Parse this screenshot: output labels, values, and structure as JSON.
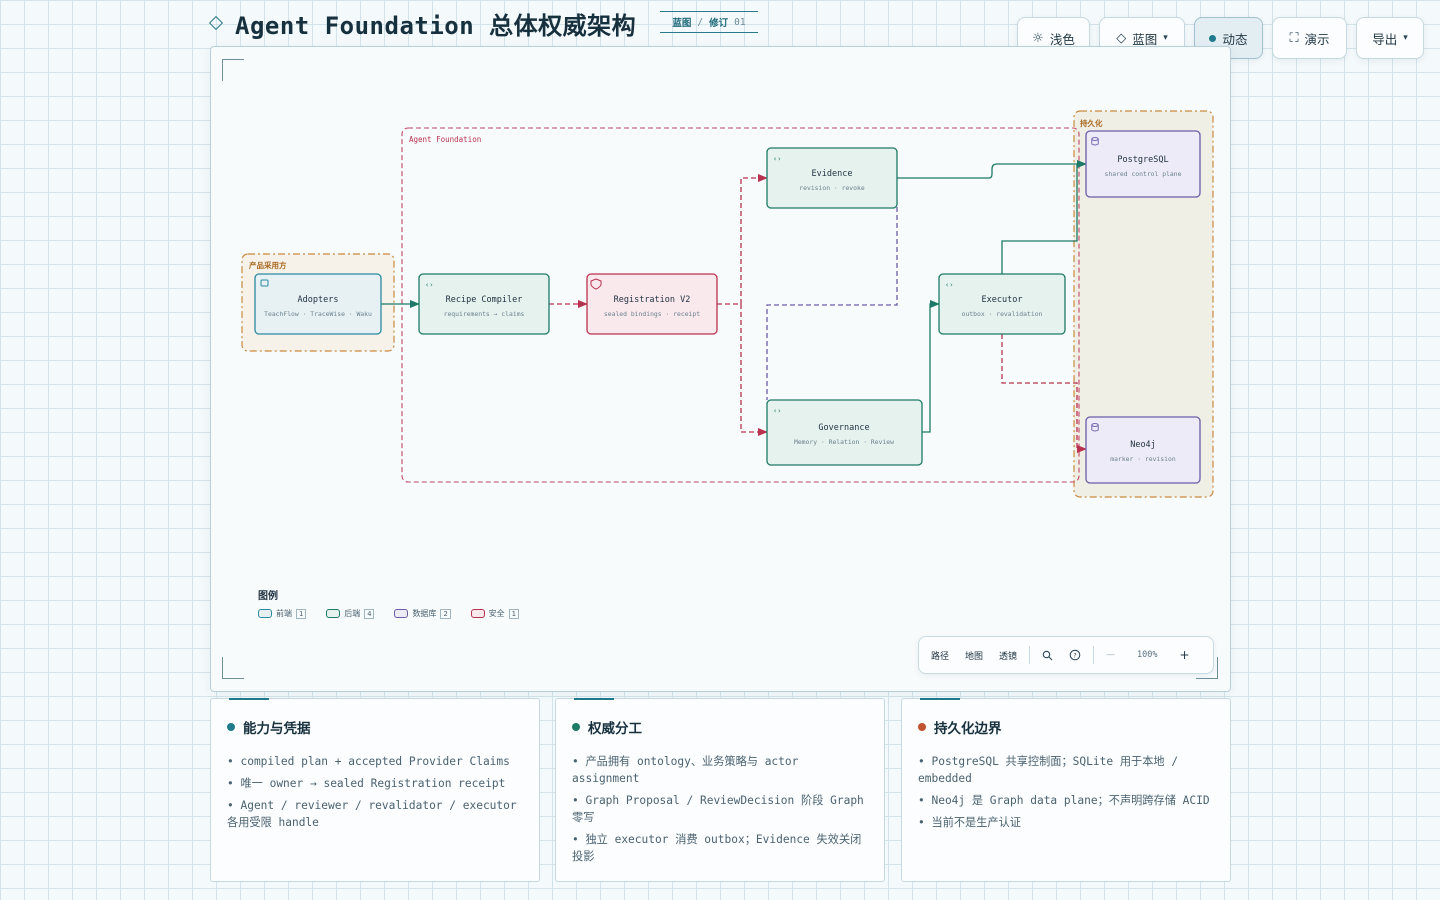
{
  "header": {
    "title": "Agent Foundation 总体权威架构",
    "badge_label": "蓝图",
    "badge_sep": "/",
    "badge_rev_label": "修订",
    "badge_rev_num": "01"
  },
  "toolbar": {
    "theme_label": "浅色",
    "view_label": "蓝图",
    "motion_label": "动态",
    "present_label": "演示",
    "export_label": "导出"
  },
  "diagram": {
    "groups": {
      "adopters": "产品采用方",
      "foundation": "Agent Foundation",
      "persistence": "持久化"
    },
    "nodes": {
      "adopters": {
        "title": "Adopters",
        "sub": "TeachFlow · TraceWise · Waku"
      },
      "recipe": {
        "title": "Recipe Compiler",
        "sub": "requirements → claims"
      },
      "registration": {
        "title": "Registration V2",
        "sub": "sealed bindings · receipt"
      },
      "evidence": {
        "title": "Evidence",
        "sub": "revision · revoke"
      },
      "governance": {
        "title": "Governance",
        "sub": "Memory · Relation · Review"
      },
      "executor": {
        "title": "Executor",
        "sub": "outbox · revalidation"
      },
      "postgres": {
        "title": "PostgreSQL",
        "sub": "shared control plane"
      },
      "neo4j": {
        "title": "Neo4j",
        "sub": "marker · revision"
      }
    },
    "colors": {
      "teal": "#1d7a66",
      "teal_fill": "#e6f2ee",
      "crimson": "#b8324f",
      "crimson_fill": "#f9e8ec",
      "purple": "#6b5ca8",
      "purple_fill": "#eeebf8",
      "amber": "#c98a3e"
    }
  },
  "legend": {
    "title": "图例",
    "items": [
      {
        "label": "前端",
        "count": "1",
        "color": "#2a8aa0"
      },
      {
        "label": "后端",
        "count": "4",
        "color": "#1d7a66"
      },
      {
        "label": "数据库",
        "count": "2",
        "color": "#6b5ca8"
      },
      {
        "label": "安全",
        "count": "1",
        "color": "#b8324f"
      }
    ]
  },
  "controls": {
    "path": "路径",
    "map": "地图",
    "lens": "透镜",
    "zoom": "100%",
    "minus": "—",
    "plus": "+"
  },
  "cards": [
    {
      "title": "能力与凭据",
      "dot_color": "#1f7a8c",
      "items": [
        "• compiled plan + accepted Provider Claims",
        "• 唯一 owner → sealed Registration receipt",
        "• Agent / reviewer / revalidator / executor 各用受限 handle"
      ]
    },
    {
      "title": "权威分工",
      "dot_color": "#1d7a66",
      "items": [
        "• 产品拥有 ontology、业务策略与 actor assignment",
        "• Graph Proposal / ReviewDecision 阶段 Graph 零写",
        "• 独立 executor 消费 outbox；Evidence 失效关闭投影"
      ]
    },
    {
      "title": "持久化边界",
      "dot_color": "#c0532e",
      "items": [
        "• PostgreSQL 共享控制面；SQLite 用于本地 / embedded",
        "• Neo4j 是 Graph data plane；不声明跨存储 ACID",
        "• 当前不是生产认证"
      ]
    }
  ]
}
